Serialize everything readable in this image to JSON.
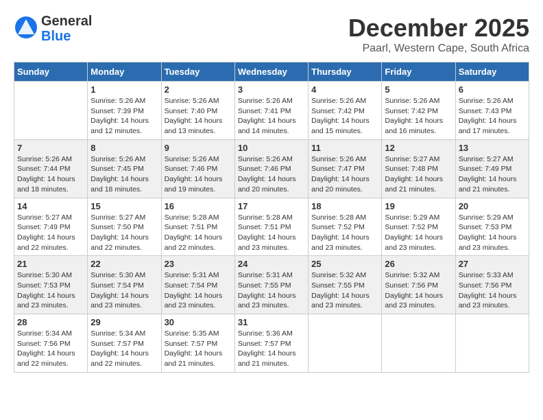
{
  "logo": {
    "general": "General",
    "blue": "Blue"
  },
  "title": "December 2025",
  "subtitle": "Paarl, Western Cape, South Africa",
  "headers": [
    "Sunday",
    "Monday",
    "Tuesday",
    "Wednesday",
    "Thursday",
    "Friday",
    "Saturday"
  ],
  "weeks": [
    [
      {
        "day": "",
        "info": ""
      },
      {
        "day": "1",
        "info": "Sunrise: 5:26 AM\nSunset: 7:39 PM\nDaylight: 14 hours\nand 12 minutes."
      },
      {
        "day": "2",
        "info": "Sunrise: 5:26 AM\nSunset: 7:40 PM\nDaylight: 14 hours\nand 13 minutes."
      },
      {
        "day": "3",
        "info": "Sunrise: 5:26 AM\nSunset: 7:41 PM\nDaylight: 14 hours\nand 14 minutes."
      },
      {
        "day": "4",
        "info": "Sunrise: 5:26 AM\nSunset: 7:42 PM\nDaylight: 14 hours\nand 15 minutes."
      },
      {
        "day": "5",
        "info": "Sunrise: 5:26 AM\nSunset: 7:42 PM\nDaylight: 14 hours\nand 16 minutes."
      },
      {
        "day": "6",
        "info": "Sunrise: 5:26 AM\nSunset: 7:43 PM\nDaylight: 14 hours\nand 17 minutes."
      }
    ],
    [
      {
        "day": "7",
        "info": "Sunrise: 5:26 AM\nSunset: 7:44 PM\nDaylight: 14 hours\nand 18 minutes."
      },
      {
        "day": "8",
        "info": "Sunrise: 5:26 AM\nSunset: 7:45 PM\nDaylight: 14 hours\nand 18 minutes."
      },
      {
        "day": "9",
        "info": "Sunrise: 5:26 AM\nSunset: 7:46 PM\nDaylight: 14 hours\nand 19 minutes."
      },
      {
        "day": "10",
        "info": "Sunrise: 5:26 AM\nSunset: 7:46 PM\nDaylight: 14 hours\nand 20 minutes."
      },
      {
        "day": "11",
        "info": "Sunrise: 5:26 AM\nSunset: 7:47 PM\nDaylight: 14 hours\nand 20 minutes."
      },
      {
        "day": "12",
        "info": "Sunrise: 5:27 AM\nSunset: 7:48 PM\nDaylight: 14 hours\nand 21 minutes."
      },
      {
        "day": "13",
        "info": "Sunrise: 5:27 AM\nSunset: 7:49 PM\nDaylight: 14 hours\nand 21 minutes."
      }
    ],
    [
      {
        "day": "14",
        "info": "Sunrise: 5:27 AM\nSunset: 7:49 PM\nDaylight: 14 hours\nand 22 minutes."
      },
      {
        "day": "15",
        "info": "Sunrise: 5:27 AM\nSunset: 7:50 PM\nDaylight: 14 hours\nand 22 minutes."
      },
      {
        "day": "16",
        "info": "Sunrise: 5:28 AM\nSunset: 7:51 PM\nDaylight: 14 hours\nand 22 minutes."
      },
      {
        "day": "17",
        "info": "Sunrise: 5:28 AM\nSunset: 7:51 PM\nDaylight: 14 hours\nand 23 minutes."
      },
      {
        "day": "18",
        "info": "Sunrise: 5:28 AM\nSunset: 7:52 PM\nDaylight: 14 hours\nand 23 minutes."
      },
      {
        "day": "19",
        "info": "Sunrise: 5:29 AM\nSunset: 7:52 PM\nDaylight: 14 hours\nand 23 minutes."
      },
      {
        "day": "20",
        "info": "Sunrise: 5:29 AM\nSunset: 7:53 PM\nDaylight: 14 hours\nand 23 minutes."
      }
    ],
    [
      {
        "day": "21",
        "info": "Sunrise: 5:30 AM\nSunset: 7:53 PM\nDaylight: 14 hours\nand 23 minutes."
      },
      {
        "day": "22",
        "info": "Sunrise: 5:30 AM\nSunset: 7:54 PM\nDaylight: 14 hours\nand 23 minutes."
      },
      {
        "day": "23",
        "info": "Sunrise: 5:31 AM\nSunset: 7:54 PM\nDaylight: 14 hours\nand 23 minutes."
      },
      {
        "day": "24",
        "info": "Sunrise: 5:31 AM\nSunset: 7:55 PM\nDaylight: 14 hours\nand 23 minutes."
      },
      {
        "day": "25",
        "info": "Sunrise: 5:32 AM\nSunset: 7:55 PM\nDaylight: 14 hours\nand 23 minutes."
      },
      {
        "day": "26",
        "info": "Sunrise: 5:32 AM\nSunset: 7:56 PM\nDaylight: 14 hours\nand 23 minutes."
      },
      {
        "day": "27",
        "info": "Sunrise: 5:33 AM\nSunset: 7:56 PM\nDaylight: 14 hours\nand 23 minutes."
      }
    ],
    [
      {
        "day": "28",
        "info": "Sunrise: 5:34 AM\nSunset: 7:56 PM\nDaylight: 14 hours\nand 22 minutes."
      },
      {
        "day": "29",
        "info": "Sunrise: 5:34 AM\nSunset: 7:57 PM\nDaylight: 14 hours\nand 22 minutes."
      },
      {
        "day": "30",
        "info": "Sunrise: 5:35 AM\nSunset: 7:57 PM\nDaylight: 14 hours\nand 21 minutes."
      },
      {
        "day": "31",
        "info": "Sunrise: 5:36 AM\nSunset: 7:57 PM\nDaylight: 14 hours\nand 21 minutes."
      },
      {
        "day": "",
        "info": ""
      },
      {
        "day": "",
        "info": ""
      },
      {
        "day": "",
        "info": ""
      }
    ]
  ]
}
